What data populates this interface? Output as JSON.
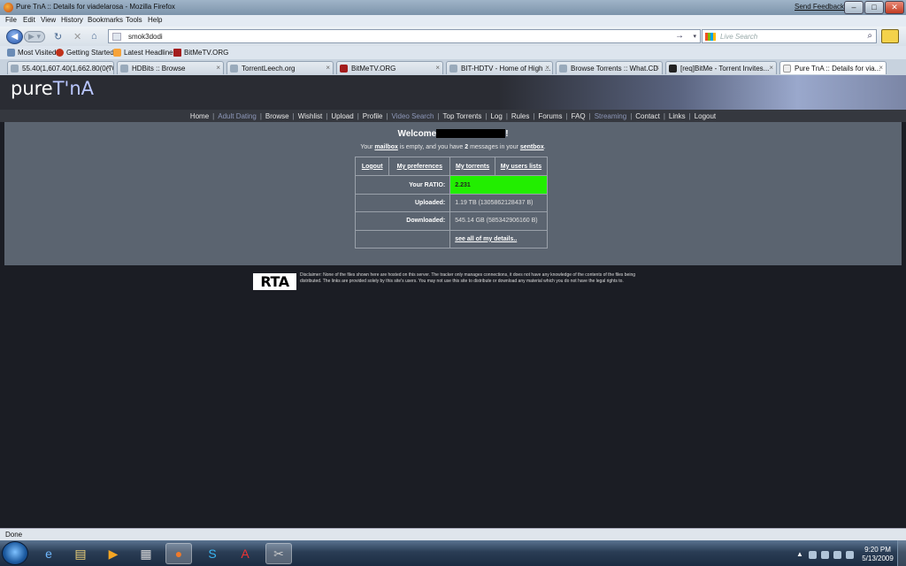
{
  "window": {
    "title": "Pure TnA :: Details for viadelarosa - Mozilla Firefox",
    "send_feedback": "Send Feedback",
    "minimize": "–",
    "maximize": "□",
    "close": "✕"
  },
  "menu": [
    "File",
    "Edit",
    "View",
    "History",
    "Bookmarks",
    "Tools",
    "Help"
  ],
  "nav": {
    "url": "smok3dodi",
    "search_placeholder": "Live Search",
    "back": "◀",
    "forward": "▶ ▾",
    "reload": "↻",
    "stop": "✕",
    "home": "⌂",
    "go": "→"
  },
  "bookmarks": [
    "Most Visited",
    "Getting Started",
    "Latest Headlines",
    "BitMeTV.ORG"
  ],
  "tabs": [
    {
      "label": "55.40(1,607.40(1,662.80(0(70..."
    },
    {
      "label": "HDBits :: Browse"
    },
    {
      "label": "TorrentLeech.org"
    },
    {
      "label": "BitMeTV.ORG"
    },
    {
      "label": "BIT-HDTV - Home of High ..."
    },
    {
      "label": "Browse Torrents :: What.CD"
    },
    {
      "label": "[req]BitMe - Torrent Invites..."
    },
    {
      "label": "Pure TnA :: Details for via..."
    }
  ],
  "site": {
    "logo_a": "pure",
    "logo_b": "T'nA",
    "nav": [
      {
        "label": "Home",
        "dim": false
      },
      {
        "label": "Adult Dating",
        "dim": true
      },
      {
        "label": "Browse",
        "dim": false
      },
      {
        "label": "Wishlist",
        "dim": false
      },
      {
        "label": "Upload",
        "dim": false
      },
      {
        "label": "Profile",
        "dim": false
      },
      {
        "label": "Video Search",
        "dim": true
      },
      {
        "label": "Top Torrents",
        "dim": false
      },
      {
        "label": "Log",
        "dim": false
      },
      {
        "label": "Rules",
        "dim": false
      },
      {
        "label": "Forums",
        "dim": false
      },
      {
        "label": "FAQ",
        "dim": false
      },
      {
        "label": "Streaming",
        "dim": true
      },
      {
        "label": "Contact",
        "dim": false
      },
      {
        "label": "Links",
        "dim": false
      },
      {
        "label": "Logout",
        "dim": false
      }
    ],
    "welcome": "Welcome",
    "welcome_end": "!",
    "mail": {
      "pre": "Your ",
      "mailbox": "mailbox",
      "mid": " is empty, and you have ",
      "count": "2",
      "post": " messages in your ",
      "sentbox": "sentbox",
      "end": "."
    },
    "links": [
      "Logout",
      "My preferences",
      "My torrents",
      "My users lists"
    ],
    "ratio_label": "Your RATIO:",
    "ratio": "2.231",
    "uploaded_label": "Uploaded:",
    "uploaded": "1.19 TB (1305862128437 B)",
    "downloaded_label": "Downloaded:",
    "downloaded": "545.14 GB (585342906160 B)",
    "details_link": "see all of my details..",
    "rta": "RTA",
    "disclaimer": "Disclaimer: None of the files shown here are hosted on this server. The tracker only manages connections, it does not have any knowledge of the contents of the files being distributed. The links are provided solely by this site's users. You may not use this site to distribute or download any material which you do not have the legal rights to."
  },
  "status": "Done",
  "clock": {
    "time": "9:20 PM",
    "date": "5/13/2009"
  },
  "taskbar_icons": [
    "ie-icon",
    "explorer-icon",
    "media-player-icon",
    "calculator-icon",
    "firefox-icon",
    "skype-icon",
    "acrobat-icon",
    "tool-icon"
  ]
}
